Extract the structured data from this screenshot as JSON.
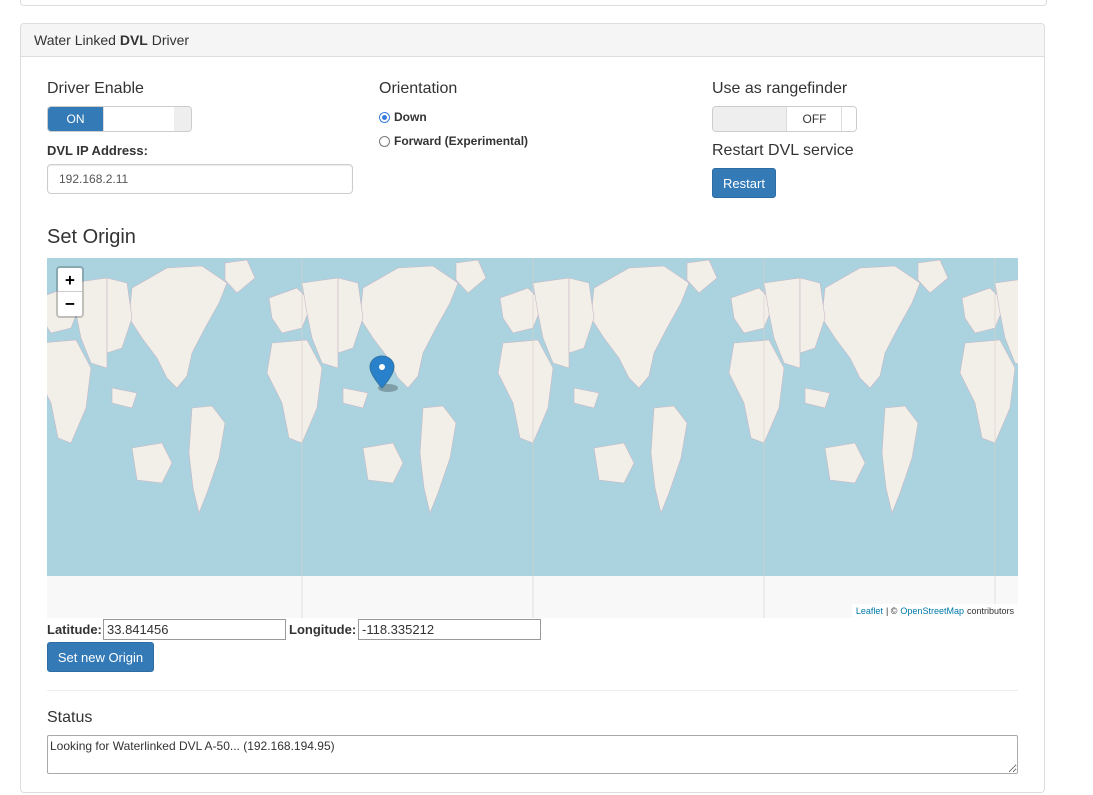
{
  "panel": {
    "title_prefix": "Water Linked ",
    "title_bold": "DVL",
    "title_suffix": " Driver"
  },
  "driver_enable": {
    "label": "Driver Enable",
    "on_label": "ON",
    "state": "on"
  },
  "ip": {
    "label": "DVL IP Address:",
    "value": "192.168.2.11"
  },
  "orientation": {
    "label": "Orientation",
    "options": [
      "Down",
      "Forward (Experimental)"
    ],
    "selected": "Down"
  },
  "rangefinder": {
    "label": "Use as rangefinder",
    "off_label": "OFF",
    "state": "off"
  },
  "restart": {
    "label": "Restart DVL service",
    "button": "Restart"
  },
  "origin": {
    "title": "Set Origin",
    "latitude_label": "Latitude:",
    "latitude": "33.841456",
    "longitude_label": "Longitude:",
    "longitude": "-118.335212",
    "button": "Set new Origin"
  },
  "map": {
    "zoom_in": "+",
    "zoom_out": "−",
    "attribution_leaflet": "Leaflet",
    "attribution_sep": "| ©",
    "attribution_osm": "OpenStreetMap",
    "attribution_suffix": "contributors",
    "marker_icon": "map-marker-icon",
    "colors": {
      "water": "#aad3df",
      "land": "#f2efe9",
      "ice": "#f8f8f8",
      "marker": "#2a81cb"
    }
  },
  "status": {
    "label": "Status",
    "text": "Looking for Waterlinked DVL A-50... (192.168.194.95)"
  }
}
